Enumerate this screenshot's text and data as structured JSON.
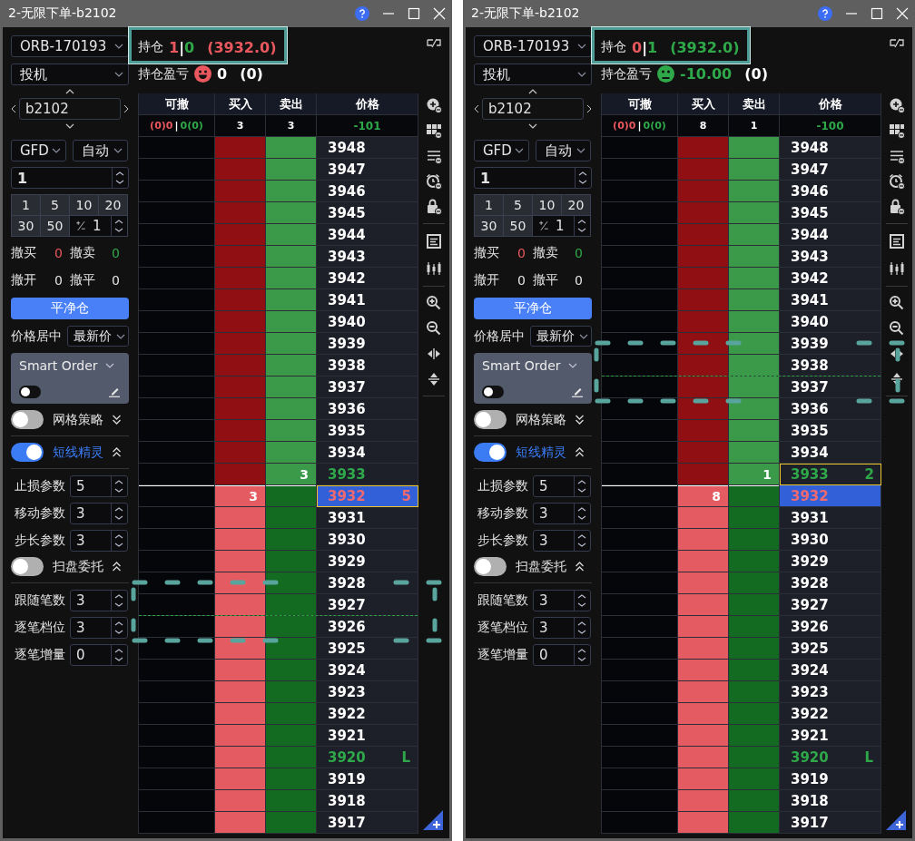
{
  "windows": [
    {
      "title": "2-无限下单-b2102",
      "annotated": true,
      "position": {
        "label": "持仓",
        "long": "1",
        "separator": "|",
        "short": "0",
        "average": "(3932.0)",
        "color": "#e8585e"
      },
      "pnl": {
        "label": "持仓盈亏",
        "smiling": true,
        "value": "0",
        "color": "#ffffff",
        "extra": "(0)"
      },
      "account": "ORB-170193",
      "hedge": "投机",
      "symbol": "b2102",
      "validity": "GFD",
      "offset": "自动",
      "quantity": "1",
      "quick_quantities": [
        "1",
        "5",
        "10",
        "20",
        "30",
        "50"
      ],
      "step": "1",
      "cancel_stats": [
        {
          "label": "撤买",
          "value": "0",
          "color": "#e8585e"
        },
        {
          "label": "撤卖",
          "value": "0",
          "color": "#2fa84a"
        },
        {
          "label": "撤开",
          "value": "0",
          "color": "#e2e2e2"
        },
        {
          "label": "撤平",
          "value": "0",
          "color": "#e2e2e2"
        }
      ],
      "flatten_button": "平净仓",
      "center": {
        "label": "价格居中",
        "value": "最新价"
      },
      "smart_order": {
        "label": "Smart Order",
        "on": false
      },
      "strategies": [
        {
          "kind": "toggle",
          "label": "网格策略",
          "on": false,
          "expanded": false
        },
        {
          "kind": "toggle",
          "label": "短线精灵",
          "on": true,
          "expanded": true
        },
        {
          "kind": "param",
          "label": "止损参数",
          "value": "5"
        },
        {
          "kind": "param",
          "label": "移动参数",
          "value": "3"
        },
        {
          "kind": "param",
          "label": "步长参数",
          "value": "3"
        },
        {
          "kind": "toggle",
          "label": "扫盘委托",
          "on": false,
          "expanded": true
        },
        {
          "kind": "param",
          "label": "跟随笔数",
          "value": "3"
        },
        {
          "kind": "param",
          "label": "逐笔档位",
          "value": "3"
        },
        {
          "kind": "param",
          "label": "逐笔增量",
          "value": "0"
        }
      ],
      "ladder": {
        "columns": [
          "可撤",
          "买入",
          "卖出",
          "价格"
        ],
        "totals": {
          "cancel_buy": "(0)0",
          "separator": "|",
          "cancel_sell": "0(0)",
          "buy": "3",
          "sell": "3",
          "net": "-101"
        },
        "rows": [
          {
            "price": "3948",
            "bid": false,
            "color": "#ffffff",
            "selected": false,
            "focused": false,
            "guide": false
          },
          {
            "price": "3947",
            "bid": false,
            "color": "#ffffff",
            "selected": false,
            "focused": false,
            "guide": false
          },
          {
            "price": "3946",
            "bid": false,
            "color": "#ffffff",
            "selected": false,
            "focused": false,
            "guide": false
          },
          {
            "price": "3945",
            "bid": false,
            "color": "#ffffff",
            "selected": false,
            "focused": false,
            "guide": false
          },
          {
            "price": "3944",
            "bid": false,
            "color": "#ffffff",
            "selected": false,
            "focused": false,
            "guide": false
          },
          {
            "price": "3943",
            "bid": false,
            "color": "#ffffff",
            "selected": false,
            "focused": false,
            "guide": false
          },
          {
            "price": "3942",
            "bid": false,
            "color": "#ffffff",
            "selected": false,
            "focused": false,
            "guide": false
          },
          {
            "price": "3941",
            "bid": false,
            "color": "#ffffff",
            "selected": false,
            "focused": false,
            "guide": false
          },
          {
            "price": "3940",
            "bid": false,
            "color": "#ffffff",
            "selected": false,
            "focused": false,
            "guide": false
          },
          {
            "price": "3939",
            "bid": false,
            "color": "#ffffff",
            "selected": false,
            "focused": false,
            "guide": false
          },
          {
            "price": "3938",
            "bid": false,
            "color": "#ffffff",
            "selected": false,
            "focused": false,
            "guide": false
          },
          {
            "price": "3937",
            "bid": false,
            "color": "#ffffff",
            "selected": false,
            "focused": false,
            "guide": false
          },
          {
            "price": "3936",
            "bid": false,
            "color": "#ffffff",
            "selected": false,
            "focused": false,
            "guide": false
          },
          {
            "price": "3935",
            "bid": false,
            "color": "#ffffff",
            "selected": false,
            "focused": false,
            "guide": false
          },
          {
            "price": "3934",
            "bid": false,
            "color": "#ffffff",
            "selected": false,
            "focused": false,
            "guide": false
          },
          {
            "price": "3933",
            "bid": false,
            "sell": "3",
            "color": "#2fa84a",
            "selected": false,
            "focused": false,
            "guide": false
          },
          {
            "price": "3932",
            "bid": true,
            "buy": "3",
            "mark": "5",
            "color": "#ef6a70",
            "selected": true,
            "focused": true,
            "guide": false
          },
          {
            "price": "3931",
            "bid": true,
            "color": "#ffffff",
            "selected": false,
            "focused": false,
            "guide": false
          },
          {
            "price": "3930",
            "bid": true,
            "color": "#ffffff",
            "selected": false,
            "focused": false,
            "guide": false
          },
          {
            "price": "3929",
            "bid": true,
            "color": "#ffffff",
            "selected": false,
            "focused": false,
            "guide": false
          },
          {
            "price": "3928",
            "bid": true,
            "color": "#ffffff",
            "selected": false,
            "focused": false,
            "guide": false
          },
          {
            "price": "3927",
            "bid": true,
            "color": "#ffffff",
            "selected": false,
            "focused": false,
            "guide": true
          },
          {
            "price": "3926",
            "bid": true,
            "color": "#ffffff",
            "selected": false,
            "focused": false,
            "guide": false
          },
          {
            "price": "3925",
            "bid": true,
            "color": "#ffffff",
            "selected": false,
            "focused": false,
            "guide": false
          },
          {
            "price": "3924",
            "bid": true,
            "color": "#ffffff",
            "selected": false,
            "focused": false,
            "guide": false
          },
          {
            "price": "3923",
            "bid": true,
            "color": "#ffffff",
            "selected": false,
            "focused": false,
            "guide": false
          },
          {
            "price": "3922",
            "bid": true,
            "color": "#ffffff",
            "selected": false,
            "focused": false,
            "guide": false
          },
          {
            "price": "3921",
            "bid": true,
            "color": "#ffffff",
            "selected": false,
            "focused": false,
            "guide": false
          },
          {
            "price": "3920",
            "bid": true,
            "mark": "L",
            "color": "#2fa84a",
            "selected": false,
            "focused": false,
            "guide": false
          },
          {
            "price": "3919",
            "bid": true,
            "color": "#ffffff",
            "selected": false,
            "focused": false,
            "guide": false
          },
          {
            "price": "3918",
            "bid": true,
            "color": "#ffffff",
            "selected": false,
            "focused": false,
            "guide": false
          },
          {
            "price": "3917",
            "bid": true,
            "color": "#ffffff",
            "selected": false,
            "focused": false,
            "guide": false
          }
        ]
      }
    },
    {
      "title": "2-无限下单-b2102",
      "annotated": true,
      "position": {
        "label": "持仓",
        "long": "0",
        "separator": "|",
        "short": "1",
        "average": "(3932.0)",
        "color": "#2fa84a"
      },
      "pnl": {
        "label": "持仓盈亏",
        "smiling": false,
        "value": "-10.00",
        "color": "#2fa84a",
        "extra": "(0)"
      },
      "account": "ORB-170193",
      "hedge": "投机",
      "symbol": "b2102",
      "validity": "GFD",
      "offset": "自动",
      "quantity": "1",
      "quick_quantities": [
        "1",
        "5",
        "10",
        "20",
        "30",
        "50"
      ],
      "step": "1",
      "cancel_stats": [
        {
          "label": "撤买",
          "value": "0",
          "color": "#e8585e"
        },
        {
          "label": "撤卖",
          "value": "0",
          "color": "#2fa84a"
        },
        {
          "label": "撤开",
          "value": "0",
          "color": "#e2e2e2"
        },
        {
          "label": "撤平",
          "value": "0",
          "color": "#e2e2e2"
        }
      ],
      "flatten_button": "平净仓",
      "center": {
        "label": "价格居中",
        "value": "最新价"
      },
      "smart_order": {
        "label": "Smart Order",
        "on": false
      },
      "strategies": [
        {
          "kind": "toggle",
          "label": "网格策略",
          "on": false,
          "expanded": false
        },
        {
          "kind": "toggle",
          "label": "短线精灵",
          "on": true,
          "expanded": true
        },
        {
          "kind": "param",
          "label": "止损参数",
          "value": "5"
        },
        {
          "kind": "param",
          "label": "移动参数",
          "value": "3"
        },
        {
          "kind": "param",
          "label": "步长参数",
          "value": "3"
        },
        {
          "kind": "toggle",
          "label": "扫盘委托",
          "on": false,
          "expanded": true
        },
        {
          "kind": "param",
          "label": "跟随笔数",
          "value": "3"
        },
        {
          "kind": "param",
          "label": "逐笔档位",
          "value": "3"
        },
        {
          "kind": "param",
          "label": "逐笔增量",
          "value": "0"
        }
      ],
      "ladder": {
        "columns": [
          "可撤",
          "买入",
          "卖出",
          "价格"
        ],
        "totals": {
          "cancel_buy": "(0)0",
          "separator": "|",
          "cancel_sell": "0(0)",
          "buy": "8",
          "sell": "1",
          "net": "-100"
        },
        "rows": [
          {
            "price": "3948",
            "bid": false,
            "color": "#ffffff",
            "selected": false,
            "focused": false,
            "guide": false
          },
          {
            "price": "3947",
            "bid": false,
            "color": "#ffffff",
            "selected": false,
            "focused": false,
            "guide": false
          },
          {
            "price": "3946",
            "bid": false,
            "color": "#ffffff",
            "selected": false,
            "focused": false,
            "guide": false
          },
          {
            "price": "3945",
            "bid": false,
            "color": "#ffffff",
            "selected": false,
            "focused": false,
            "guide": false
          },
          {
            "price": "3944",
            "bid": false,
            "color": "#ffffff",
            "selected": false,
            "focused": false,
            "guide": false
          },
          {
            "price": "3943",
            "bid": false,
            "color": "#ffffff",
            "selected": false,
            "focused": false,
            "guide": false
          },
          {
            "price": "3942",
            "bid": false,
            "color": "#ffffff",
            "selected": false,
            "focused": false,
            "guide": false
          },
          {
            "price": "3941",
            "bid": false,
            "color": "#ffffff",
            "selected": false,
            "focused": false,
            "guide": false
          },
          {
            "price": "3940",
            "bid": false,
            "color": "#ffffff",
            "selected": false,
            "focused": false,
            "guide": false
          },
          {
            "price": "3939",
            "bid": false,
            "color": "#ffffff",
            "selected": false,
            "focused": false,
            "guide": false
          },
          {
            "price": "3938",
            "bid": false,
            "color": "#ffffff",
            "selected": false,
            "focused": false,
            "guide": true
          },
          {
            "price": "3937",
            "bid": false,
            "color": "#ffffff",
            "selected": false,
            "focused": false,
            "guide": false
          },
          {
            "price": "3936",
            "bid": false,
            "color": "#ffffff",
            "selected": false,
            "focused": false,
            "guide": false
          },
          {
            "price": "3935",
            "bid": false,
            "color": "#ffffff",
            "selected": false,
            "focused": false,
            "guide": false
          },
          {
            "price": "3934",
            "bid": false,
            "color": "#ffffff",
            "selected": false,
            "focused": false,
            "guide": false
          },
          {
            "price": "3933",
            "bid": false,
            "sell": "1",
            "mark": "2",
            "color": "#2fa84a",
            "selected": false,
            "focused": true,
            "guide": false
          },
          {
            "price": "3932",
            "bid": true,
            "buy": "8",
            "color": "#ef6a70",
            "selected": true,
            "focused": false,
            "guide": false
          },
          {
            "price": "3931",
            "bid": true,
            "color": "#ffffff",
            "selected": false,
            "focused": false,
            "guide": false
          },
          {
            "price": "3930",
            "bid": true,
            "color": "#ffffff",
            "selected": false,
            "focused": false,
            "guide": false
          },
          {
            "price": "3929",
            "bid": true,
            "color": "#ffffff",
            "selected": false,
            "focused": false,
            "guide": false
          },
          {
            "price": "3928",
            "bid": true,
            "color": "#ffffff",
            "selected": false,
            "focused": false,
            "guide": false
          },
          {
            "price": "3927",
            "bid": true,
            "color": "#ffffff",
            "selected": false,
            "focused": false,
            "guide": false
          },
          {
            "price": "3926",
            "bid": true,
            "color": "#ffffff",
            "selected": false,
            "focused": false,
            "guide": false
          },
          {
            "price": "3925",
            "bid": true,
            "color": "#ffffff",
            "selected": false,
            "focused": false,
            "guide": false
          },
          {
            "price": "3924",
            "bid": true,
            "color": "#ffffff",
            "selected": false,
            "focused": false,
            "guide": false
          },
          {
            "price": "3923",
            "bid": true,
            "color": "#ffffff",
            "selected": false,
            "focused": false,
            "guide": false
          },
          {
            "price": "3922",
            "bid": true,
            "color": "#ffffff",
            "selected": false,
            "focused": false,
            "guide": false
          },
          {
            "price": "3921",
            "bid": true,
            "color": "#ffffff",
            "selected": false,
            "focused": false,
            "guide": false
          },
          {
            "price": "3920",
            "bid": true,
            "mark": "L",
            "color": "#2fa84a",
            "selected": false,
            "focused": false,
            "guide": false
          },
          {
            "price": "3919",
            "bid": true,
            "color": "#ffffff",
            "selected": false,
            "focused": false,
            "guide": false
          },
          {
            "price": "3918",
            "bid": true,
            "color": "#ffffff",
            "selected": false,
            "focused": false,
            "guide": false
          },
          {
            "price": "3917",
            "bid": true,
            "color": "#ffffff",
            "selected": false,
            "focused": false,
            "guide": false
          }
        ]
      }
    }
  ]
}
